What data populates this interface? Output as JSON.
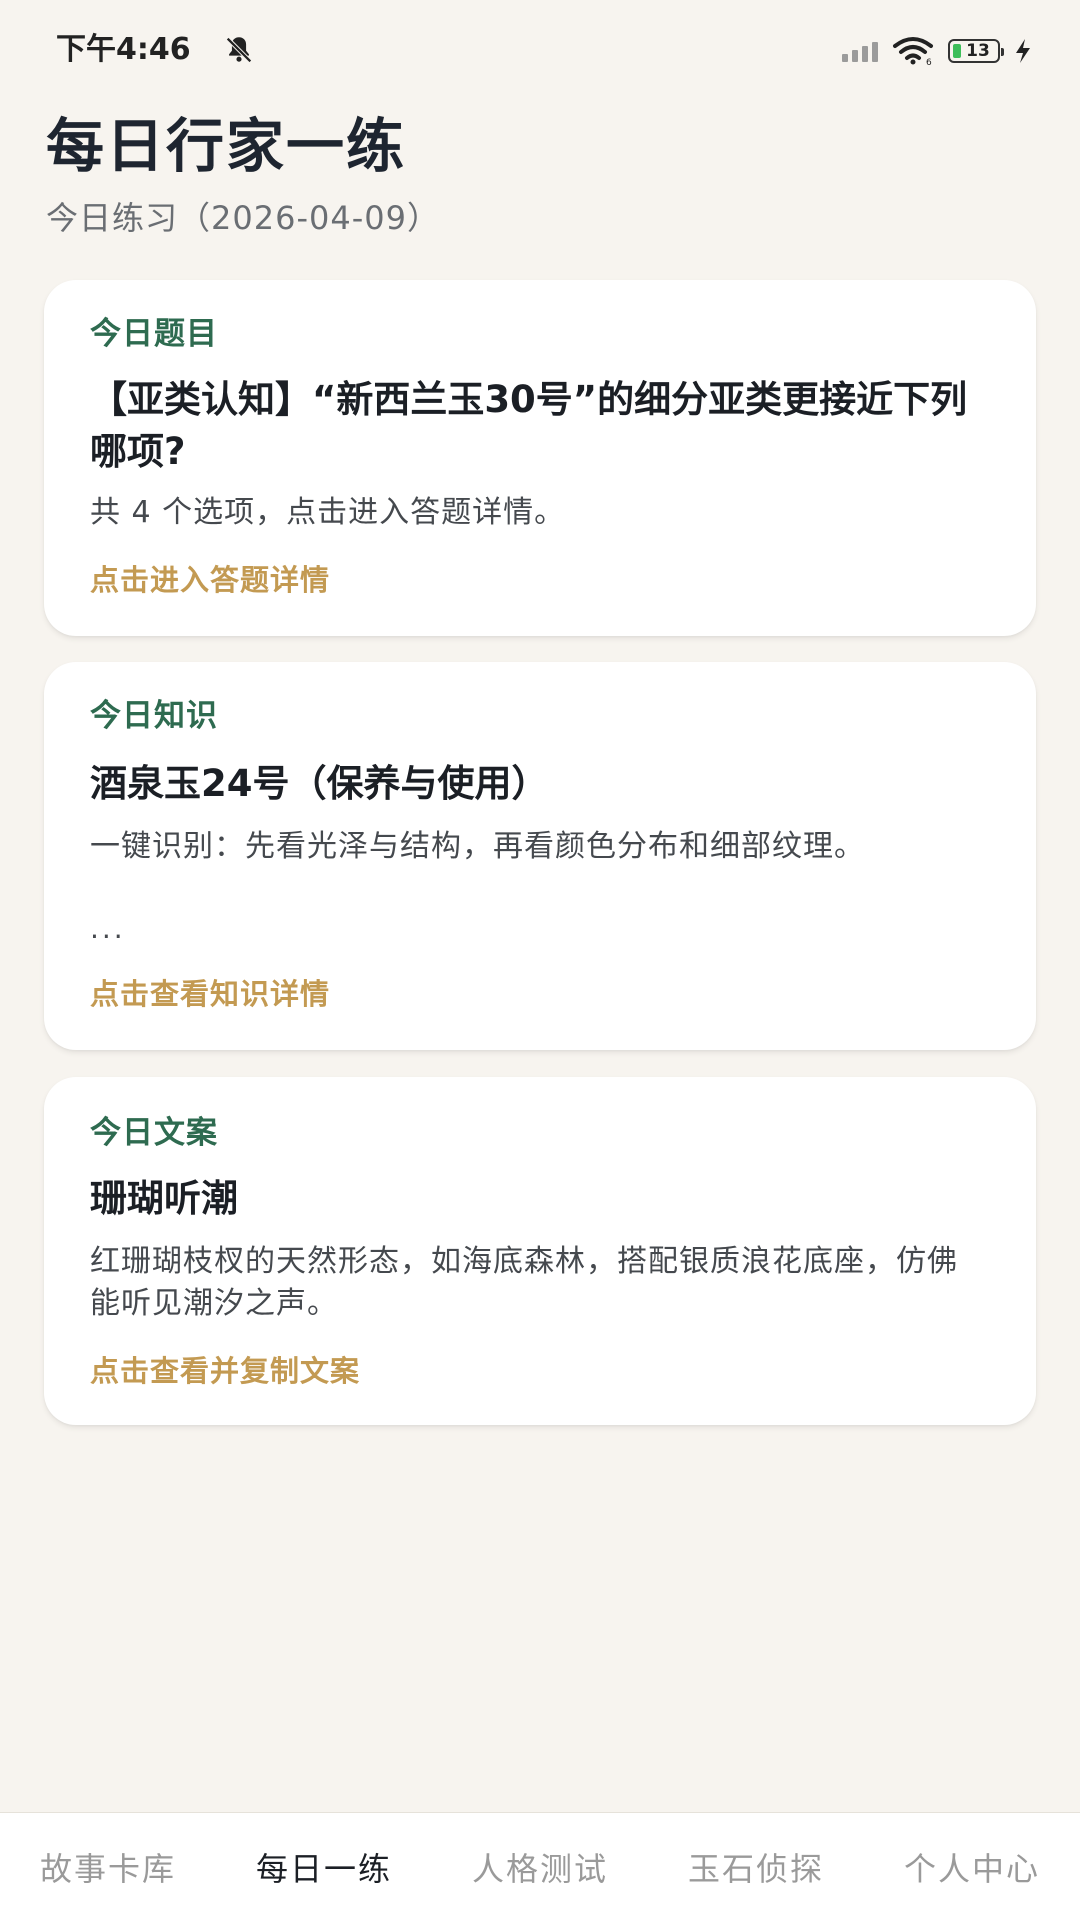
{
  "status_bar": {
    "time": "下午4:46",
    "battery_level": "13",
    "icons": [
      "bell-off-icon",
      "signal-icon",
      "wifi-icon",
      "battery-icon",
      "charging-icon"
    ]
  },
  "header": {
    "title": "每日行家一练",
    "subtitle": "今日练习（2026-04-09）"
  },
  "cards": [
    {
      "label": "今日题目",
      "heading": "【亚类认知】“新西兰玉30号”的细分亚类更接近下列哪项?",
      "body": "共 4 个选项，点击进入答题详情。",
      "link": "点击进入答题详情"
    },
    {
      "label": "今日知识",
      "heading": "酒泉玉24号（保养与使用）",
      "body": "一键识别：先看光泽与结构，再看颜色分布和细部纹理。",
      "ellipsis": "...",
      "link": "点击查看知识详情"
    },
    {
      "label": "今日文案",
      "heading": "珊瑚听潮",
      "body": "红珊瑚枝杈的天然形态，如海底森林，搭配银质浪花底座，仿佛能听见潮汐之声。",
      "link": "点击查看并复制文案"
    }
  ],
  "tabs": [
    {
      "label": "故事卡库",
      "active": false
    },
    {
      "label": "每日一练",
      "active": true
    },
    {
      "label": "人格测试",
      "active": false
    },
    {
      "label": "玉石侦探",
      "active": false
    },
    {
      "label": "个人中心",
      "active": false
    }
  ],
  "colors": {
    "background": "#F7F4EF",
    "card": "#FFFFFF",
    "label_green": "#2E6B50",
    "link_gold": "#C39A52",
    "title": "#1E2530",
    "tab_inactive": "#9A9A9A",
    "tab_active": "#1B1F25"
  }
}
